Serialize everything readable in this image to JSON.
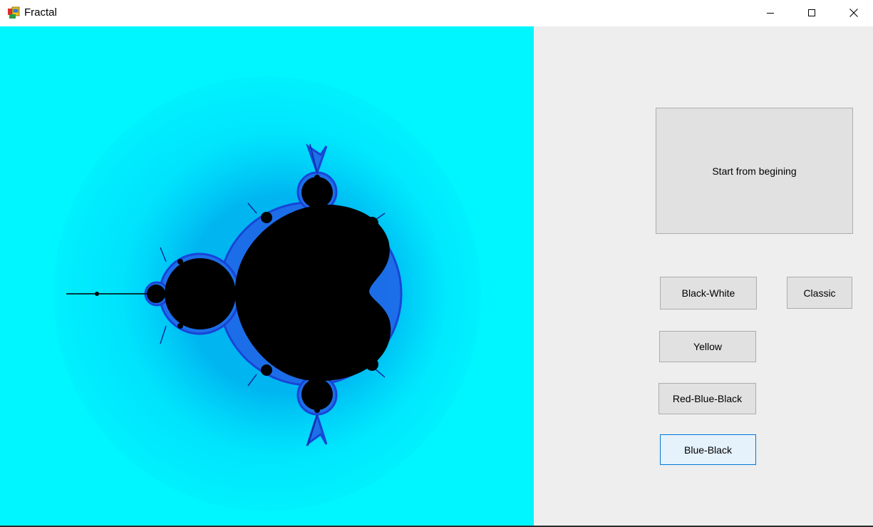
{
  "window": {
    "title": "Fractal",
    "icon": "winforms-app-icon",
    "controls": [
      "minimize-icon",
      "maximize-icon",
      "close-icon"
    ]
  },
  "canvas": {
    "content": "mandelbrot-set",
    "colors": {
      "background": "#00f6ff",
      "halo_outer": "#00e6ff",
      "halo_inner": "#00c4f4",
      "edge": "#1f4fe8",
      "set": "#000000"
    }
  },
  "controls": {
    "start_label": "Start from begining",
    "black_white_label": "Black-White",
    "classic_label": "Classic",
    "yellow_label": "Yellow",
    "red_blue_black_label": "Red-Blue-Black",
    "blue_black_label": "Blue-Black"
  },
  "colors": {
    "panel_background": "#eeeeee",
    "button_face": "#e1e1e1",
    "button_border": "#adadad",
    "focused_button_face": "#e5f1fb",
    "focused_button_border": "#0078d7"
  }
}
